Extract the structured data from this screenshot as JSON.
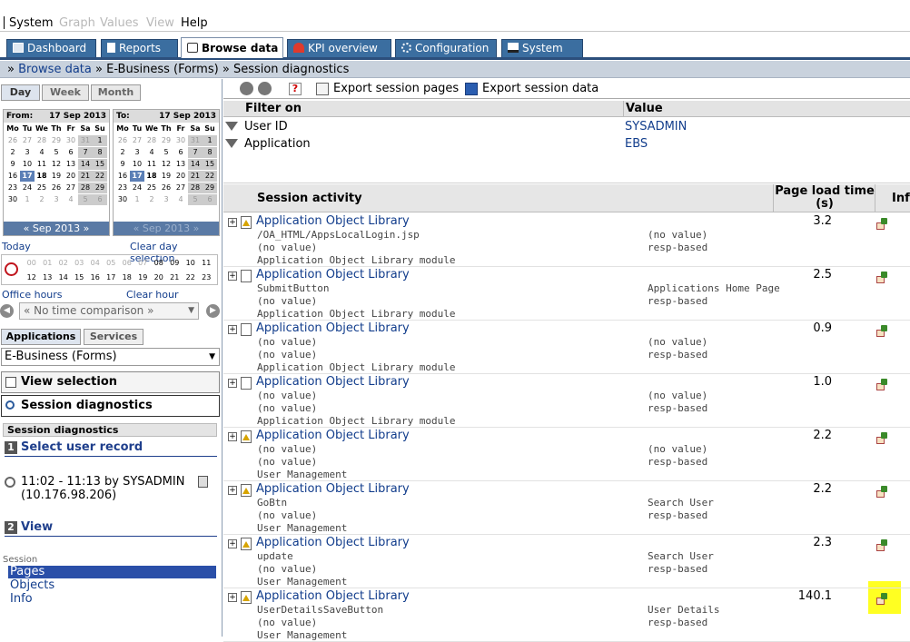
{
  "menu": {
    "system": "System",
    "graph": "Graph",
    "values": "Values",
    "view": "View",
    "help": "Help"
  },
  "tabs": [
    "Dashboard",
    "Reports",
    "Browse data",
    "KPI overview",
    "Configuration",
    "System"
  ],
  "breadcrumb": {
    "prefix": "»",
    "link": "Browse data",
    "sep1": "»",
    "item2": "E-Business (Forms)",
    "sep2": "»",
    "item3": "Session diagnostics"
  },
  "left": {
    "period_tabs": [
      "Day",
      "Week",
      "Month"
    ],
    "cal_from": {
      "label": "From:",
      "date": "17 Sep 2013",
      "month_nav": "« Sep 2013 »"
    },
    "cal_to": {
      "label": "To:",
      "date": "17 Sep 2013",
      "month_nav": "« Sep 2013 »"
    },
    "weekdays": [
      "Mo",
      "Tu",
      "We",
      "Th",
      "Fr",
      "Sa",
      "Su"
    ],
    "today": "Today",
    "clear_day": "Clear day selection",
    "hours_top": [
      "00",
      "01",
      "02",
      "03",
      "04",
      "05",
      "06",
      "07",
      "08",
      "09",
      "10",
      "11"
    ],
    "hours_bottom": [
      "12",
      "13",
      "14",
      "15",
      "16",
      "17",
      "18",
      "19",
      "20",
      "21",
      "22",
      "23"
    ],
    "office_hours": "Office hours",
    "clear_hour": "Clear hour selection",
    "comparison": "« No time comparison »",
    "app_tabs": [
      "Applications",
      "Services"
    ],
    "app_select": "E-Business (Forms)",
    "view_selection": "View selection",
    "session_diagnostics": "Session diagnostics",
    "session_box": "Session diagnostics",
    "step1": {
      "num": "1",
      "label": "Select user record"
    },
    "record_line1": "11:02 - 11:13 by SYSADMIN",
    "record_line2": "(10.176.98.206)",
    "step2": {
      "num": "2",
      "label": "View"
    },
    "session_label": "Session",
    "nav": [
      "Pages",
      "Objects",
      "Info"
    ]
  },
  "toolbar": {
    "export_pages": "Export session pages",
    "export_data": "Export session data"
  },
  "filter": {
    "header_filter": "Filter on",
    "header_value": "Value",
    "rows": [
      {
        "label": "User ID",
        "value": "SYSADMIN"
      },
      {
        "label": "Application",
        "value": "EBS"
      }
    ]
  },
  "activity": {
    "col_activity": "Session activity",
    "col_plt_1": "Page load time",
    "col_plt_2": "(s)",
    "col_info": "Inf",
    "rows": [
      {
        "title": "Application Object Library",
        "l1": "/OA_HTML/AppsLocalLogin.jsp",
        "l2": "(no value)",
        "l3": "Application Object Library module",
        "m1": "(no value)",
        "m2": "resp-based",
        "plt": "3.2",
        "warn": true
      },
      {
        "title": "Application Object Library",
        "l1": "SubmitButton",
        "l2": "(no value)",
        "l3": "Application Object Library module",
        "m1": "Applications Home Page",
        "m2": "resp-based",
        "plt": "2.5",
        "warn": false
      },
      {
        "title": "Application Object Library",
        "l1": "(no value)",
        "l2": "(no value)",
        "l3": "Application Object Library module",
        "m1": "(no value)",
        "m2": "resp-based",
        "plt": "0.9",
        "warn": false
      },
      {
        "title": "Application Object Library",
        "l1": "(no value)",
        "l2": "(no value)",
        "l3": "Application Object Library module",
        "m1": "(no value)",
        "m2": "resp-based",
        "plt": "1.0",
        "warn": false
      },
      {
        "title": "Application Object Library",
        "l1": "(no value)",
        "l2": "(no value)",
        "l3": "User Management",
        "m1": "(no value)",
        "m2": "resp-based",
        "plt": "2.2",
        "warn": true
      },
      {
        "title": "Application Object Library",
        "l1": "GoBtn",
        "l2": "(no value)",
        "l3": "User Management",
        "m1": "Search User",
        "m2": "resp-based",
        "plt": "2.2",
        "warn": true
      },
      {
        "title": "Application Object Library",
        "l1": "update",
        "l2": "(no value)",
        "l3": "User Management",
        "m1": "Search User",
        "m2": "resp-based",
        "plt": "2.3",
        "warn": true
      },
      {
        "title": "Application Object Library",
        "l1": "UserDetailsSaveButton",
        "l2": "(no value)",
        "l3": "User Management",
        "m1": "User Details",
        "m2": "resp-based",
        "plt": "140.1",
        "warn": true
      }
    ]
  }
}
